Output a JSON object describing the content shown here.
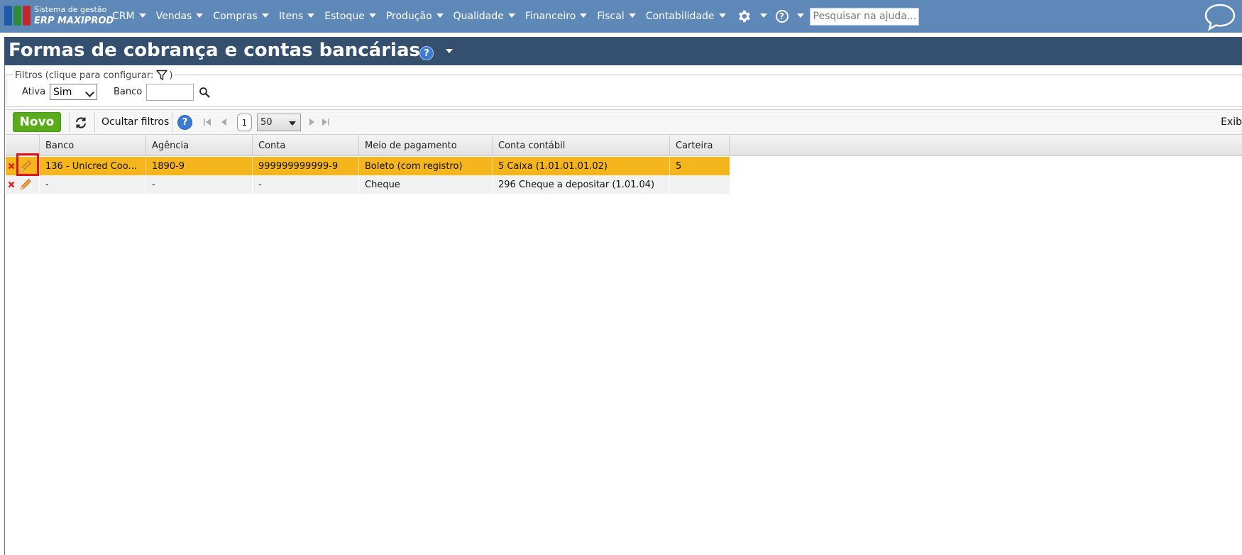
{
  "app": {
    "logo_line1": "Sistema de gestão",
    "logo_line2": "ERP MAXIPROD",
    "nav_items": [
      "CRM",
      "Vendas",
      "Compras",
      "Itens",
      "Estoque",
      "Produção",
      "Qualidade",
      "Financeiro",
      "Fiscal",
      "Contabilidade"
    ],
    "help_search_placeholder": "Pesquisar na ajuda...",
    "colors": {
      "topbar": "#5d88b7",
      "titlebar": "#34506e",
      "selected_row": "#f5b51c",
      "new_button": "#5aac1a",
      "highlight_box": "#e0141e"
    }
  },
  "page": {
    "title": "Formas de cobrança e contas bancárias"
  },
  "filters": {
    "legend": "Filtros (clique para configurar:",
    "legend_close": ")",
    "ativa_label": "Ativa",
    "ativa_value": "Sim",
    "banco_label": "Banco",
    "banco_value": ""
  },
  "toolbar": {
    "new_label": "Novo",
    "hide_filters_label": "Ocultar filtros",
    "page_number": "1",
    "per_page": "50",
    "right_label": "Exib"
  },
  "grid": {
    "columns": [
      "Banco",
      "Agência",
      "Conta",
      "Meio de pagamento",
      "Conta contábil",
      "Carteira"
    ],
    "rows": [
      {
        "banco": "136 - Unicred Coo...",
        "agencia": "1890-9",
        "conta": "999999999999-9",
        "meio": "Boleto (com registro)",
        "conta_contabil": "5 Caixa (1.01.01.01.02)",
        "carteira": "5",
        "selected": true
      },
      {
        "banco": "-",
        "agencia": "-",
        "conta": "-",
        "meio": "Cheque",
        "conta_contabil": "296 Cheque a depositar (1.01.04)",
        "carteira": "",
        "selected": false
      }
    ]
  }
}
